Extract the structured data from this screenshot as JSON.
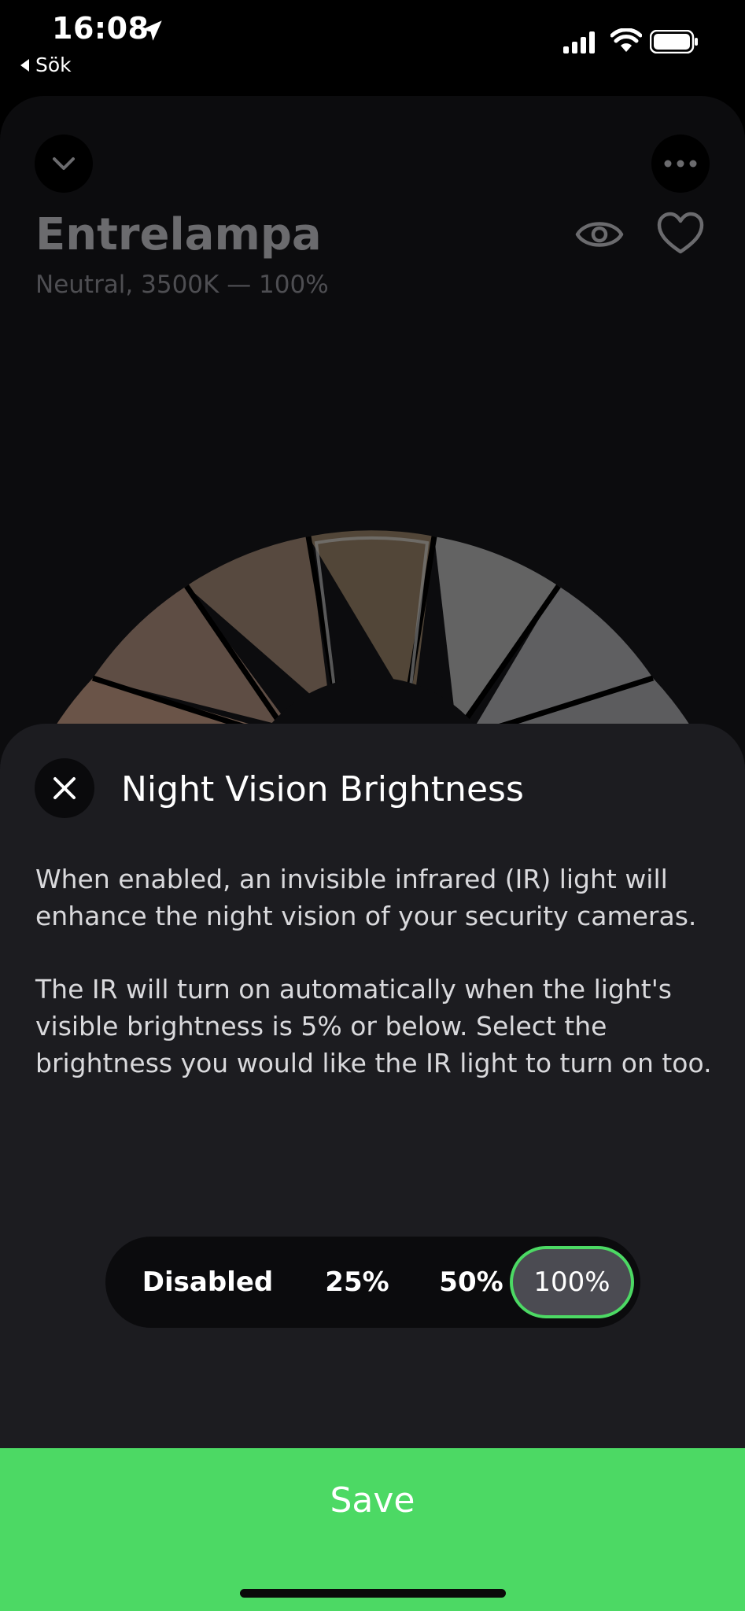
{
  "status_bar": {
    "time": "16:08",
    "back_label": "Sök"
  },
  "light": {
    "name": "Entrelampa",
    "subtitle": "Neutral, 3500K — 100%"
  },
  "sheet": {
    "title": "Night Vision Brightness",
    "paragraph1": "When enabled, an invisible infrared (IR) light will enhance the night vision of your security cameras.",
    "paragraph2": "The IR will turn on automatically when the light's visible brightness is 5% or below. Select the brightness you would like the IR light to turn on too."
  },
  "segmented": {
    "options": [
      "Disabled",
      "25%",
      "50%",
      "100%"
    ],
    "selected": "100%"
  },
  "save_label": "Save",
  "colors": {
    "accent": "#4cd964",
    "sheet_bg": "#1c1c20"
  }
}
